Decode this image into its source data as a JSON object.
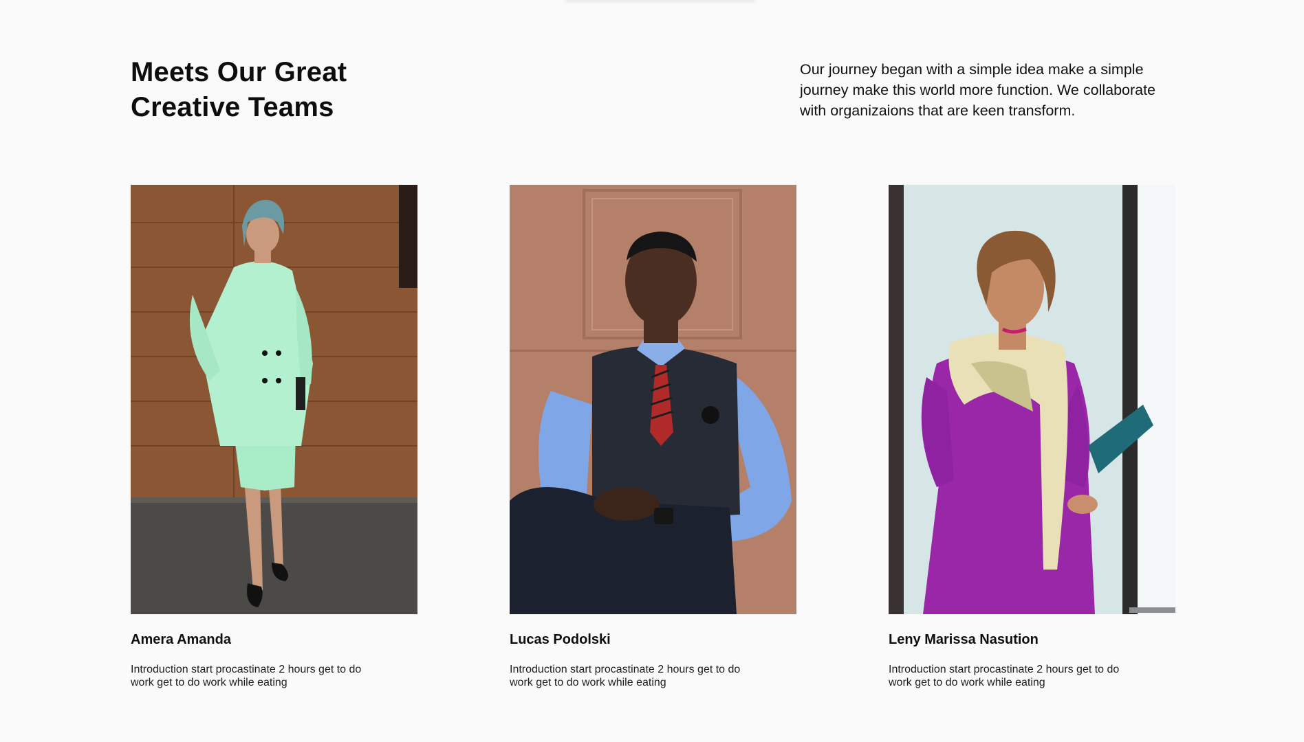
{
  "section": {
    "heading_line1": "Meets Our Great",
    "heading_line2": "Creative Teams",
    "intro": "Our journey began with a simple idea make a simple journey make this world more function. We collaborate with organizaions that are keen transform."
  },
  "team": [
    {
      "name": "Amera Amanda",
      "description": "Introduction start procastinate 2 hours get to do work get to do work while eating",
      "photo_icon": "woman-mint-suit-photo"
    },
    {
      "name": "Lucas Podolski",
      "description": "Introduction start procastinate 2 hours get to do work get to do work while eating",
      "photo_icon": "man-vest-tie-photo"
    },
    {
      "name": "Leny Marissa Nasution",
      "description": "Introduction start procastinate 2 hours get to do work get to do work while eating",
      "photo_icon": "woman-purple-dress-photo"
    }
  ]
}
